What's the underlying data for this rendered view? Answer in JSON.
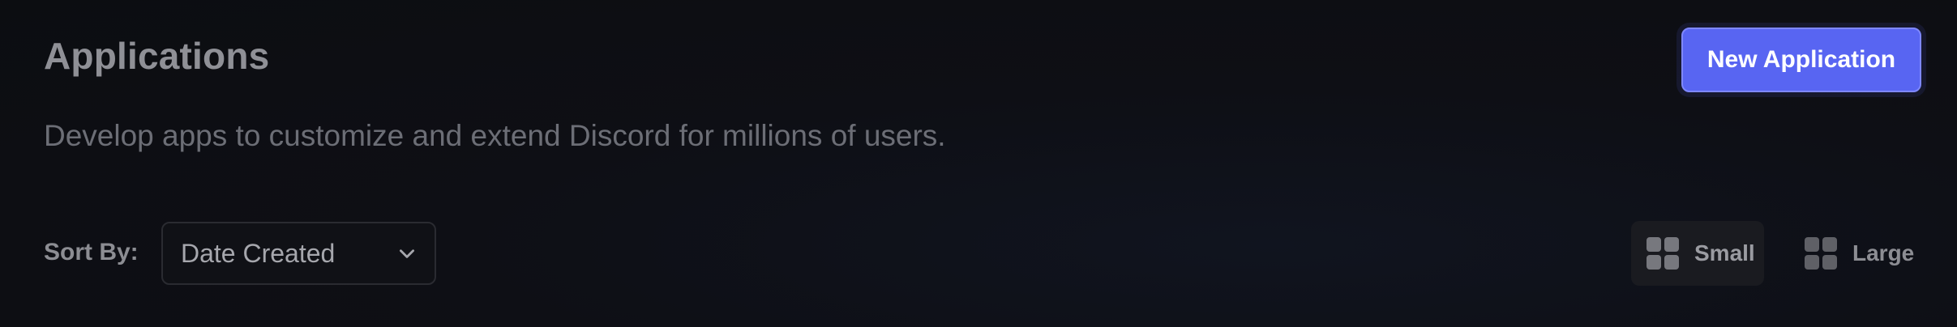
{
  "header": {
    "title": "Applications",
    "subtitle": "Develop apps to customize and extend Discord for millions of users.",
    "new_button_label": "New Application"
  },
  "sort": {
    "label": "Sort By:",
    "selected": "Date Created",
    "icon": "chevron-down-icon"
  },
  "view_toggle": {
    "options": [
      {
        "label": "Small",
        "icon": "grid-icon",
        "selected": true
      },
      {
        "label": "Large",
        "icon": "grid-icon",
        "selected": false
      }
    ]
  },
  "colors": {
    "accent": "#5865f2",
    "background": "#0e0f15"
  }
}
